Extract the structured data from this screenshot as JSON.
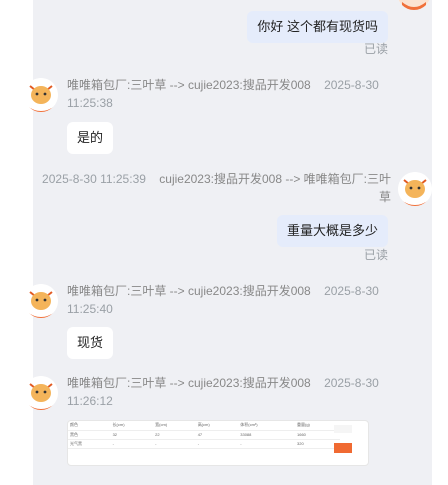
{
  "messages": [
    {
      "side": "right",
      "text": "你好 这个都有现货吗",
      "status": "已读"
    },
    {
      "side": "left",
      "sender": "唯唯箱包厂:三叶草 --> cujie2023:搜品开发008",
      "time": "2025-8-30 11:25:38",
      "text": "是的"
    },
    {
      "side": "right",
      "sender": "cujie2023:搜品开发008 --> 唯唯箱包厂:三叶草",
      "time": "2025-8-30 11:25:39",
      "text": "重量大概是多少",
      "status": "已读"
    },
    {
      "side": "left",
      "sender": "唯唯箱包厂:三叶草 --> cujie2023:搜品开发008",
      "time": "2025-8-30 11:25:40",
      "text": "现货"
    },
    {
      "side": "left",
      "sender": "唯唯箱包厂:三叶草 --> cujie2023:搜品开发008",
      "time": "2025-8-30 11:26:12"
    }
  ],
  "table_image": {
    "headers": [
      "颜色",
      "长(cm)",
      "宽(cm)",
      "高(cm)",
      "体积(cm³)",
      "重量(g)"
    ],
    "rows": [
      [
        "黑色",
        "32",
        "22",
        "47",
        "33088",
        "1660"
      ],
      [
        "光气黑",
        "-",
        "-",
        "-",
        "-",
        "320"
      ]
    ]
  },
  "colors": {
    "panel_bg": "#eff0f4",
    "right_bubble": "#e5ecfb",
    "left_bubble": "#ffffff",
    "avatar_orange": "#f0703a"
  }
}
